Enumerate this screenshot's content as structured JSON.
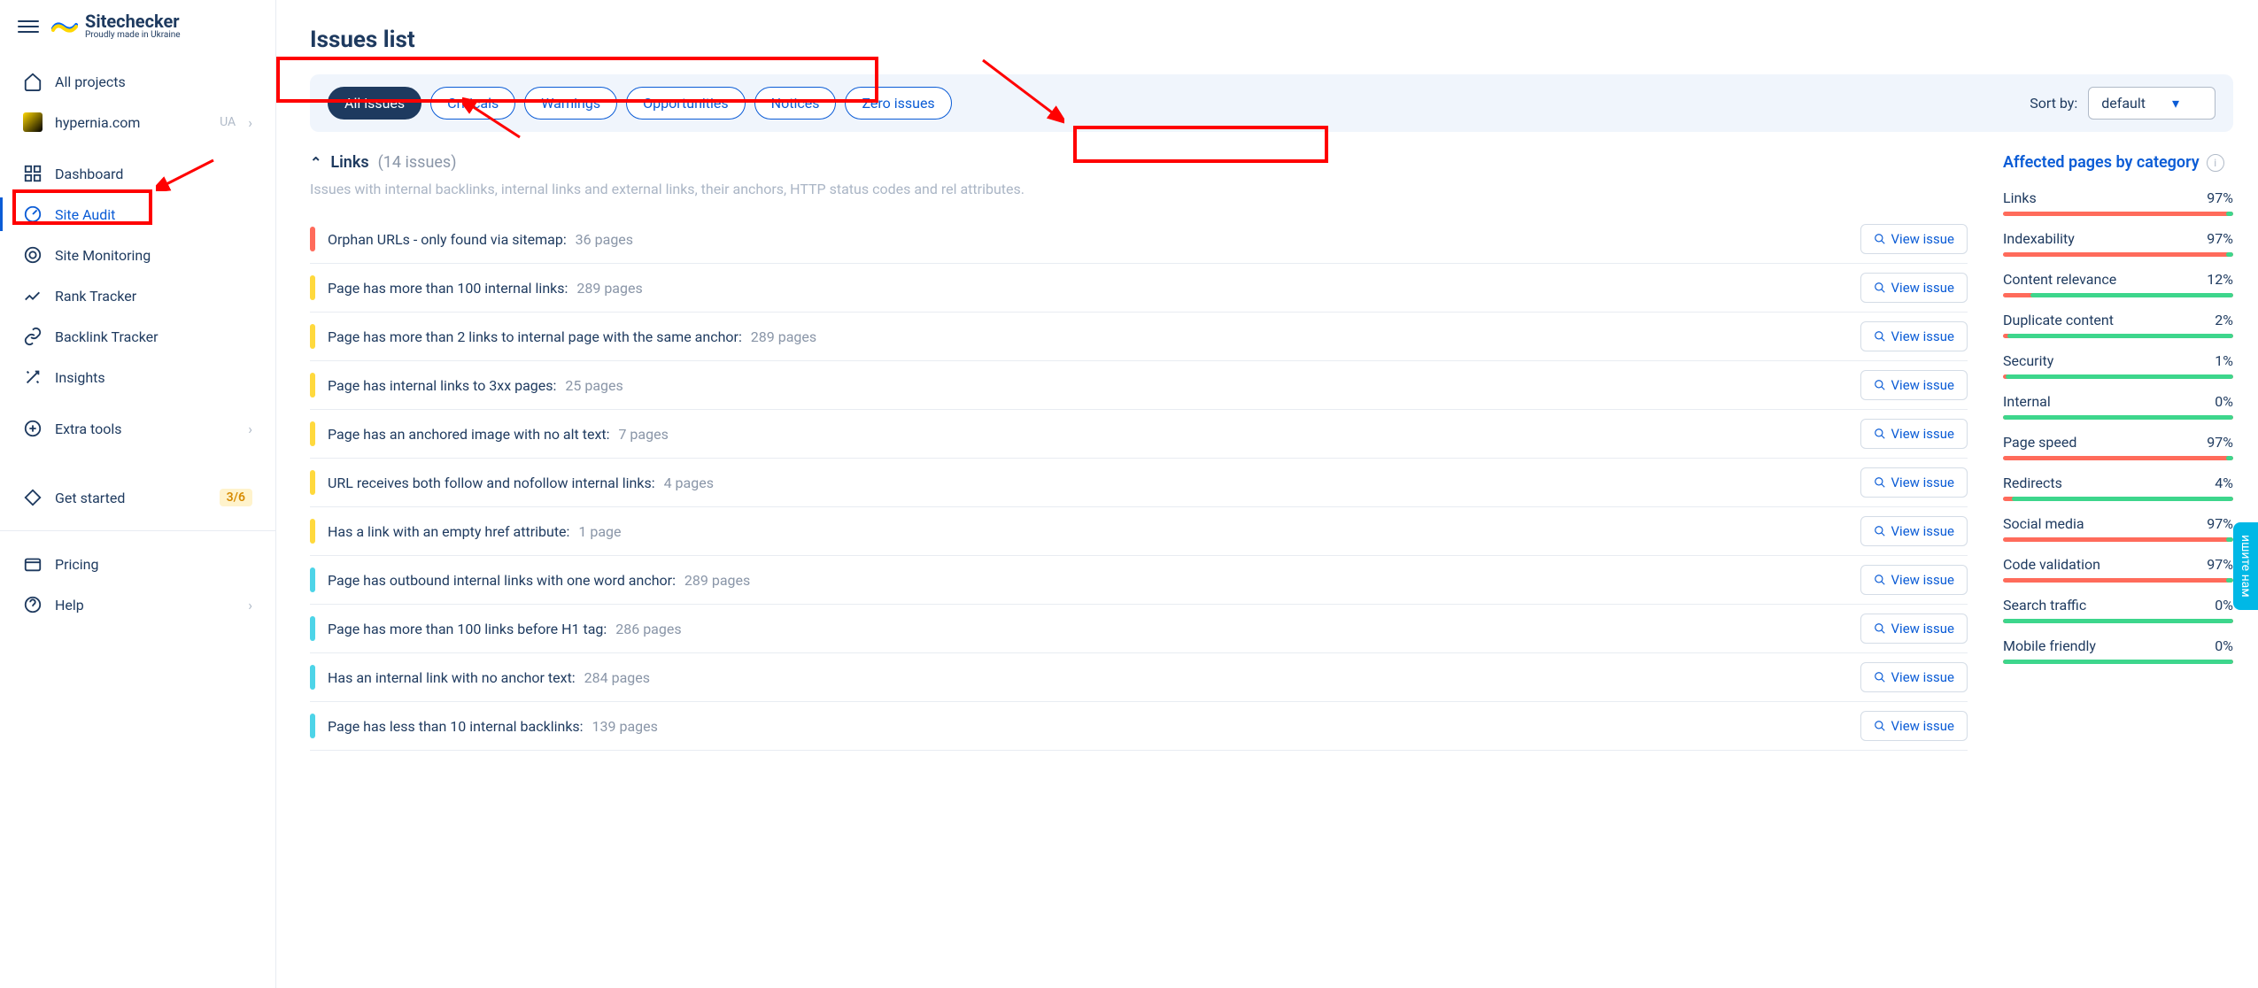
{
  "brand": {
    "name": "Sitechecker",
    "tagline": "Proudly made in Ukraine"
  },
  "sidebar": {
    "all_projects": "All projects",
    "project_name": "hypernia.com",
    "project_tag": "UA",
    "items": [
      {
        "label": "Dashboard"
      },
      {
        "label": "Site Audit"
      },
      {
        "label": "Site Monitoring"
      },
      {
        "label": "Rank Tracker"
      },
      {
        "label": "Backlink Tracker"
      },
      {
        "label": "Insights"
      }
    ],
    "extra_tools": "Extra tools",
    "get_started": "Get started",
    "get_started_badge": "3/6",
    "pricing": "Pricing",
    "help": "Help"
  },
  "page": {
    "title": "Issues list"
  },
  "filters": {
    "pills": [
      "All issues",
      "Criticals",
      "Warnings",
      "Opportunities",
      "Notices",
      "Zero issues"
    ],
    "sort_label": "Sort by:",
    "sort_value": "default"
  },
  "section": {
    "name": "Links",
    "count": "(14 issues)",
    "desc": "Issues with internal backlinks, internal links and external links, their anchors, HTTP status codes and rel attributes."
  },
  "view_label": "View issue",
  "issues": [
    {
      "sev": "crit",
      "text": "Orphan URLs - only found via sitemap:",
      "pages": "36 pages"
    },
    {
      "sev": "warn",
      "text": "Page has more than 100 internal links:",
      "pages": "289 pages"
    },
    {
      "sev": "warn",
      "text": "Page has more than 2 links to internal page with the same anchor:",
      "pages": "289 pages"
    },
    {
      "sev": "warn",
      "text": "Page has internal links to 3xx pages:",
      "pages": "25 pages"
    },
    {
      "sev": "warn",
      "text": "Page has an anchored image with no alt text:",
      "pages": "7 pages"
    },
    {
      "sev": "warn",
      "text": "URL receives both follow and nofollow internal links:",
      "pages": "4 pages"
    },
    {
      "sev": "warn",
      "text": "Has a link with an empty href attribute:",
      "pages": "1 page"
    },
    {
      "sev": "opp",
      "text": "Page has outbound internal links with one word anchor:",
      "pages": "289 pages"
    },
    {
      "sev": "opp",
      "text": "Page has more than 100 links before H1 tag:",
      "pages": "286 pages"
    },
    {
      "sev": "opp",
      "text": "Has an internal link with no anchor text:",
      "pages": "284 pages"
    },
    {
      "sev": "opp",
      "text": "Page has less than 10 internal backlinks:",
      "pages": "139 pages"
    }
  ],
  "categories": {
    "title": "Affected pages by category",
    "items": [
      {
        "name": "Links",
        "pct": "97%",
        "green": 3
      },
      {
        "name": "Indexability",
        "pct": "97%",
        "green": 3
      },
      {
        "name": "Content relevance",
        "pct": "12%",
        "green": 88
      },
      {
        "name": "Duplicate content",
        "pct": "2%",
        "green": 98
      },
      {
        "name": "Security",
        "pct": "1%",
        "green": 99
      },
      {
        "name": "Internal",
        "pct": "0%",
        "green": 100
      },
      {
        "name": "Page speed",
        "pct": "97%",
        "green": 3
      },
      {
        "name": "Redirects",
        "pct": "4%",
        "green": 96
      },
      {
        "name": "Social media",
        "pct": "97%",
        "green": 3
      },
      {
        "name": "Code validation",
        "pct": "97%",
        "green": 3
      },
      {
        "name": "Search traffic",
        "pct": "0%",
        "green": 100
      },
      {
        "name": "Mobile friendly",
        "pct": "0%",
        "green": 100
      }
    ]
  },
  "chat_label": "ишите нам"
}
